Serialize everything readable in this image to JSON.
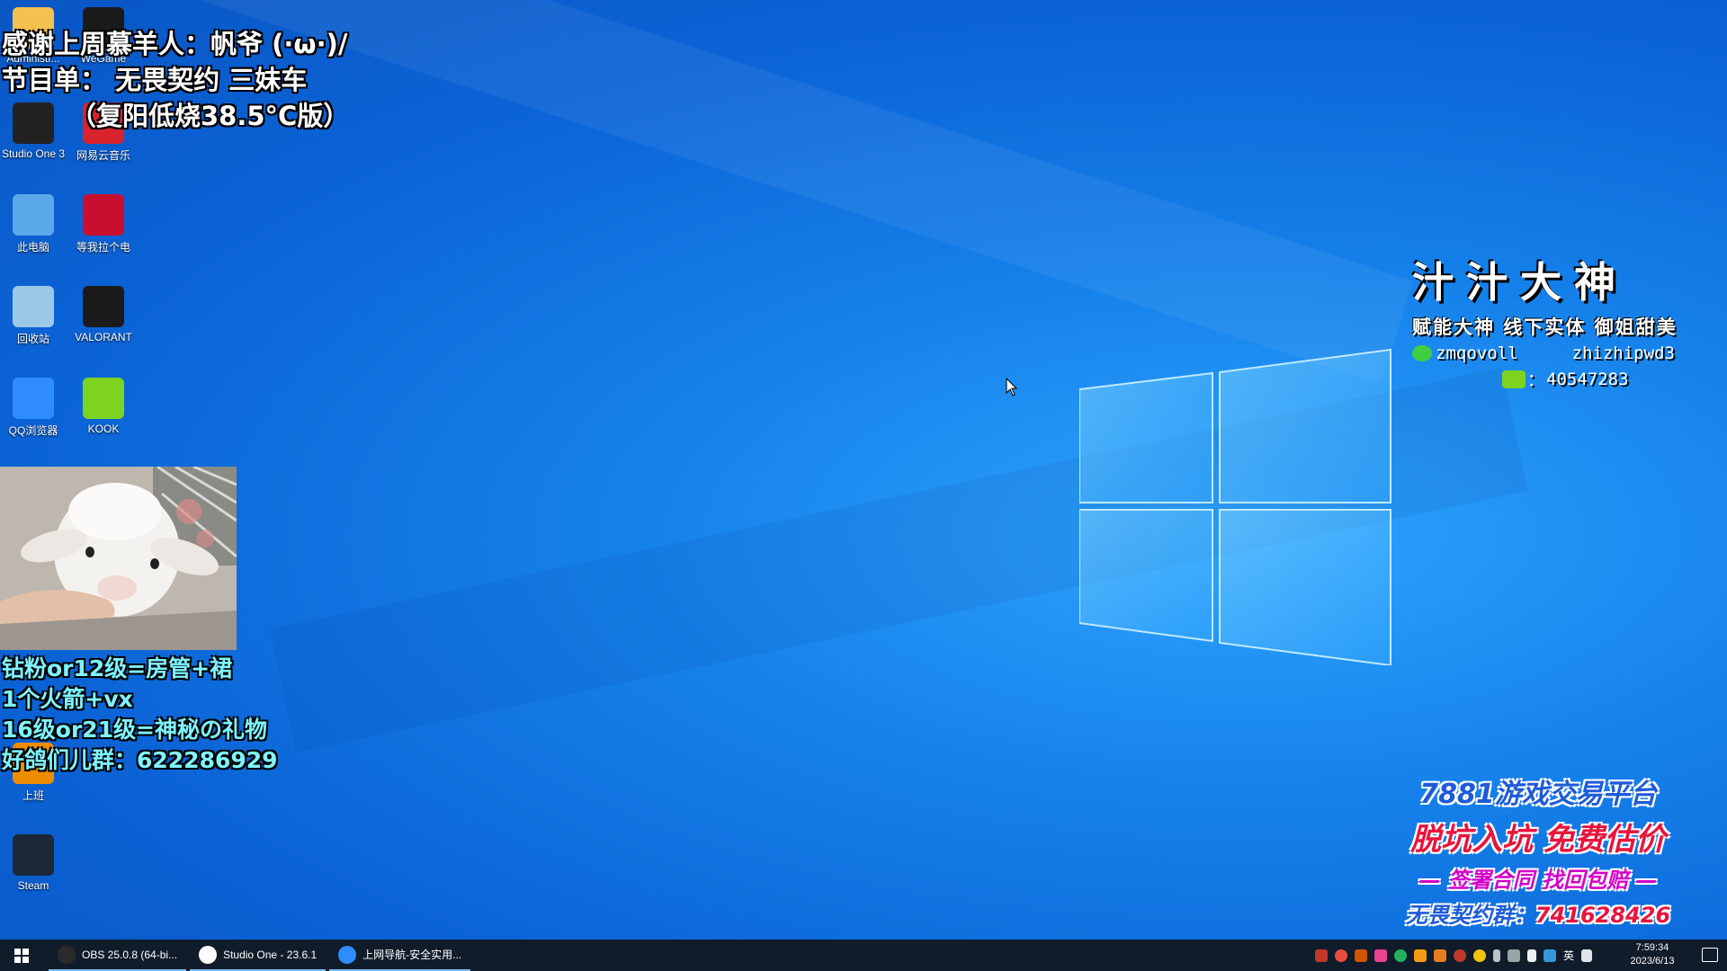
{
  "overlay_top": {
    "line1": "感谢上周慕羊人：帆爷 (·ω·)/",
    "line2": "节目单： 无畏契约 三妹车",
    "line3": "（复阳低烧38.5°C版）"
  },
  "overlay_bottom": {
    "line1": "钻粉or12级=房管+裙",
    "line2": "1个火箭+vx",
    "line3": "16级or21级=神秘の礼物",
    "line4": "好鸽们儿群：622286929"
  },
  "desktop_icons": [
    {
      "label": "Administr...",
      "color": "#f2c14e"
    },
    {
      "label": "WeGame",
      "color": "#1a1a1a"
    },
    {
      "label": "Studio One 3",
      "color": "#222222"
    },
    {
      "label": "网易云音乐",
      "color": "#d9232d"
    },
    {
      "label": "此电脑",
      "color": "#5aa8e8"
    },
    {
      "label": "等我拉个电",
      "color": "#c8102e"
    },
    {
      "label": "回收站",
      "color": "#9cc8e8"
    },
    {
      "label": "VALORANT",
      "color": "#1b1b1b"
    },
    {
      "label": "QQ浏览器",
      "color": "#2e8cff"
    },
    {
      "label": "KOOK",
      "color": "#7ed321"
    },
    {
      "label": "上班",
      "color": "#f08c00"
    },
    {
      "label": "Steam",
      "color": "#1b2838"
    }
  ],
  "brand": {
    "name": "汁汁大神",
    "tagline": "赋能大神 线下实体 御姐甜美",
    "wechat": "zmqovoll",
    "id2": "zhizhipwd3",
    "kook_prefix": "：",
    "kook": "40547283"
  },
  "ad": {
    "line1": "7881游戏交易平台",
    "line2": "脱坑入坑 免费估价",
    "line3": "— 签署合同 找回包赔 —",
    "line4_label": "无畏契约群：",
    "line4_value": "741628426",
    "colors": {
      "blue": "#1e5bd8",
      "red": "#e8143c",
      "magenta": "#d400c8"
    }
  },
  "taskbar": {
    "items": [
      {
        "label": "OBS 25.0.8 (64-bi...",
        "icon": "obs-icon"
      },
      {
        "label": "Studio One - 23.6.1",
        "icon": "studio-one-icon"
      },
      {
        "label": "上网导航-安全实用...",
        "icon": "qq-browser-icon"
      }
    ],
    "ime": "英",
    "time": "7:59:34",
    "date": "2023/6/13"
  }
}
